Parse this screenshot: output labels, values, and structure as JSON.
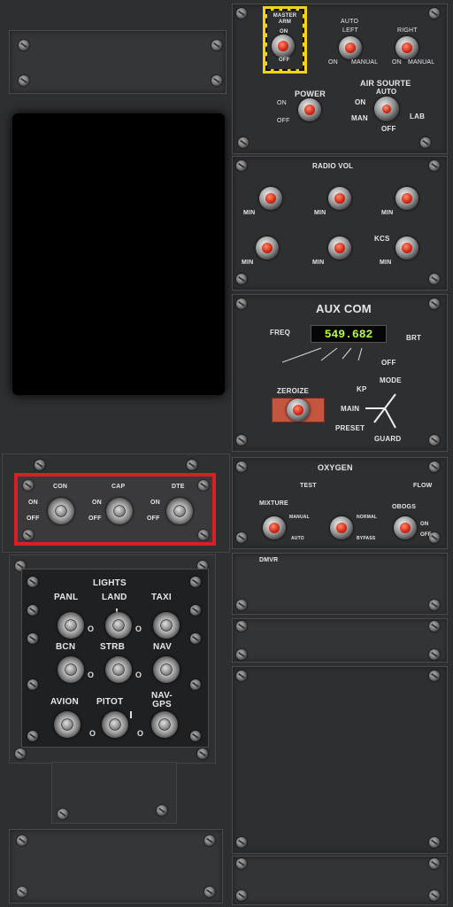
{
  "armament": {
    "master_arm": "MASTER ARM",
    "on": "ON",
    "off": "OFF",
    "auto": "AUTO",
    "left": "LEFT",
    "right": "RIGHT",
    "on2": "ON",
    "manual": "MANUAL",
    "on3": "ON",
    "manual2": "MANUAL",
    "power": "POWER",
    "power_on": "ON",
    "power_off": "OFF",
    "air_source": "AIR SOURTE",
    "as_auto": "AUTO",
    "as_on": "ON",
    "as_man": "MAN",
    "as_lab": "LAB",
    "as_off": "OFF"
  },
  "radio_vol": {
    "title": "RADIO VOL",
    "min": "MIN",
    "kcs": "KCS"
  },
  "aux_com": {
    "title": "AUX COM",
    "freq_label": "FREQ",
    "freq_value": "549.682",
    "brt": "BRT",
    "off": "OFF",
    "mode": "MODE",
    "kp": "KP",
    "zeroize": "ZEROIZE",
    "main": "MAIN",
    "preset": "PRESET",
    "guard": "GUARD",
    "display_color": "#b4ff3c",
    "zeroize_color": "#c4553f"
  },
  "comms": {
    "con": "CON",
    "cap": "CAP",
    "dte": "DTE",
    "on": "ON",
    "off": "OFF",
    "frame_color": "#d62024"
  },
  "oxygen": {
    "title": "OXYGEN",
    "test": "TEST",
    "flow": "FLOW",
    "mixture": "MIXTURE",
    "manual": "MANUAL",
    "auto": "AUTO",
    "normal": "NORMAL",
    "bypass": "BYPASS",
    "obogs": "OBOGS",
    "on": "ON",
    "off": "OFF"
  },
  "dmvr": {
    "title": "DMVR"
  },
  "lights": {
    "title": "LIGHTS",
    "panl": "PANL",
    "land": "LAND",
    "taxi": "TAXI",
    "bcn": "BCN",
    "strb": "STRB",
    "nav": "NAV",
    "avion": "AVION",
    "pitot": "PITOT",
    "nav_gps": "NAV-\nGPS",
    "off_mark": "O"
  }
}
